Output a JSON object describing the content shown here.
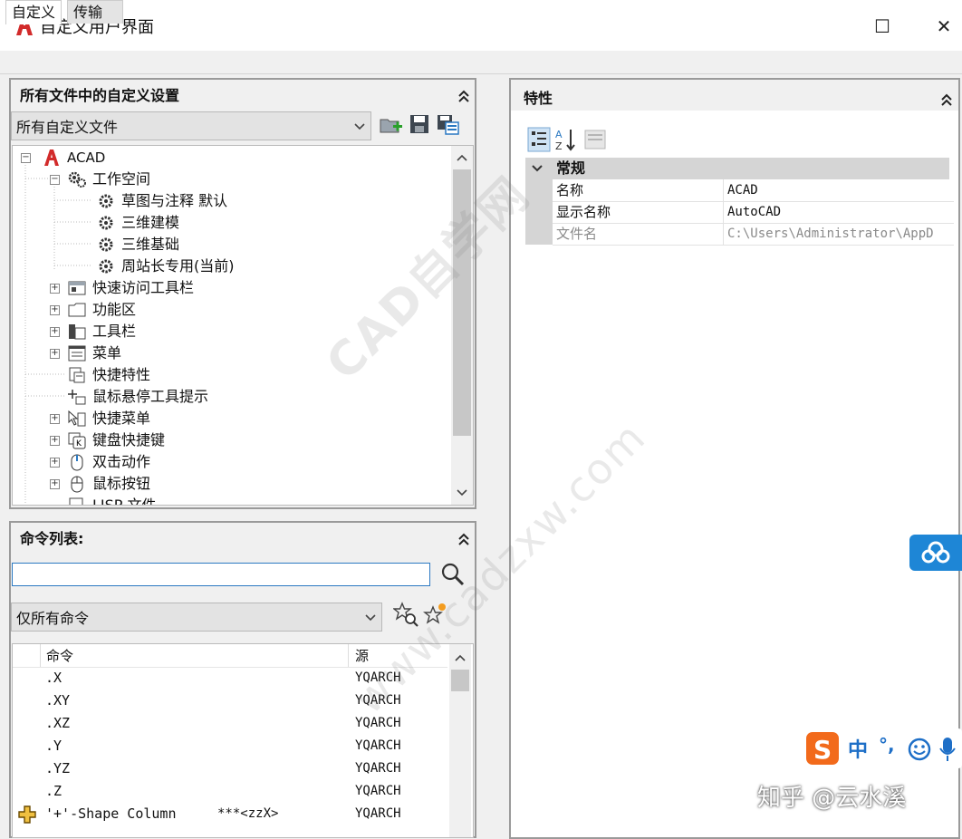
{
  "window": {
    "title": "自定义用户界面",
    "maximize_glyph": "☐",
    "close_glyph": "✕"
  },
  "tabs": [
    {
      "label": "自定义"
    },
    {
      "label": "传输"
    }
  ],
  "customizations_panel": {
    "title": "所有文件中的自定义设置",
    "dropdown_value": "所有自定义文件",
    "tree": [
      {
        "label": "ACAD"
      },
      {
        "label": "工作空间"
      },
      {
        "label": "草图与注释 默认"
      },
      {
        "label": "三维建模"
      },
      {
        "label": "三维基础"
      },
      {
        "label": "周站长专用(当前)"
      },
      {
        "label": "快速访问工具栏"
      },
      {
        "label": "功能区"
      },
      {
        "label": "工具栏"
      },
      {
        "label": "菜单"
      },
      {
        "label": "快捷特性"
      },
      {
        "label": "鼠标悬停工具提示"
      },
      {
        "label": "快捷菜单"
      },
      {
        "label": "键盘快捷键"
      },
      {
        "label": "双击动作"
      },
      {
        "label": "鼠标按钮"
      },
      {
        "label": "LISP 文件"
      }
    ]
  },
  "command_panel": {
    "title": "命令列表:",
    "search_value": "",
    "filter_value": "仅所有命令",
    "columns": {
      "command": "命令",
      "source": "源"
    },
    "rows": [
      {
        "command": ".X",
        "macro": "",
        "source": "YQARCH"
      },
      {
        "command": ".XY",
        "macro": "",
        "source": "YQARCH"
      },
      {
        "command": ".XZ",
        "macro": "",
        "source": "YQARCH"
      },
      {
        "command": ".Y",
        "macro": "",
        "source": "YQARCH"
      },
      {
        "command": ".YZ",
        "macro": "",
        "source": "YQARCH"
      },
      {
        "command": ".Z",
        "macro": "",
        "source": "YQARCH"
      },
      {
        "command": "'+'-Shape Column",
        "macro": "***<zzX>",
        "source": "YQARCH"
      }
    ]
  },
  "properties_panel": {
    "title": "特性",
    "category": "常规",
    "rows": [
      {
        "name": "名称",
        "value": "ACAD"
      },
      {
        "name": "显示名称",
        "value": "AutoCAD"
      },
      {
        "name": "文件名",
        "value": "C:\\Users\\Administrator\\AppD"
      }
    ]
  },
  "overlays": {
    "watermark": "CAD自学网",
    "watermark_url": "www.cadzxw.com",
    "ime_label": "中",
    "ime_punct": "°,",
    "credit": "知乎 @云水溪"
  },
  "colors": {
    "accent_blue": "#2b79c2",
    "autocad_red": "#d22b2b",
    "ime_orange": "#f26a1b"
  }
}
